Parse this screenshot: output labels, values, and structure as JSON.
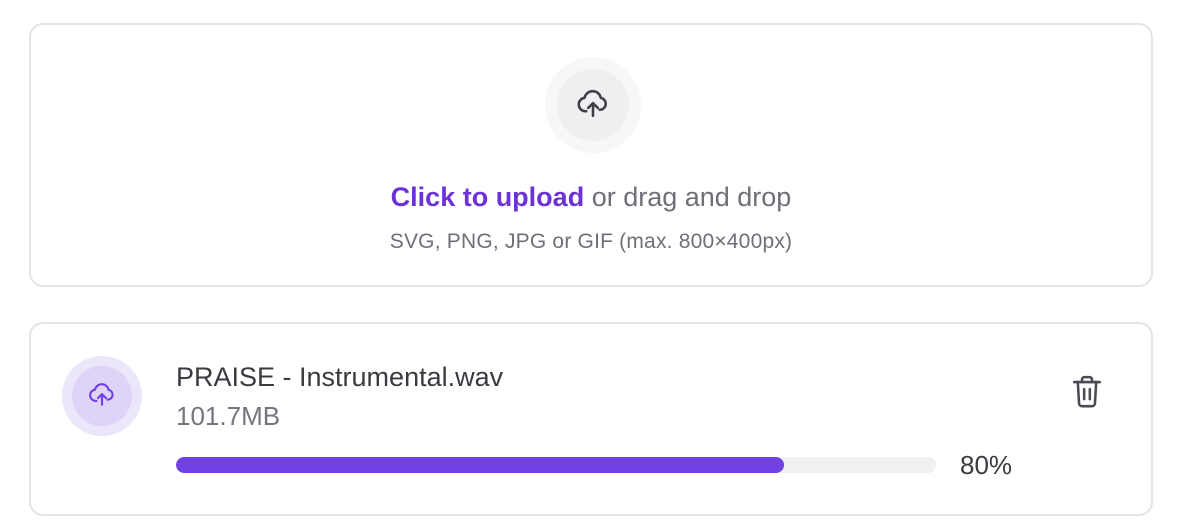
{
  "dropzone": {
    "icon": "cloud-upload-icon",
    "link_text": "Click to upload",
    "rest_text": " or drag and drop",
    "hint": "SVG, PNG, JPG or GIF (max. 800×400px)"
  },
  "file": {
    "icon": "cloud-upload-icon",
    "name": "PRAISE - Instrumental.wav",
    "size": "101.7MB",
    "progress_percent": 80,
    "progress_label": "80%",
    "delete_icon": "trash-icon"
  },
  "colors": {
    "accent": "#6d32d6",
    "progress_fill": "#7141e3",
    "progress_track": "#f0f0f2",
    "border": "#e4e4e7",
    "muted_text": "#6f6f78"
  }
}
